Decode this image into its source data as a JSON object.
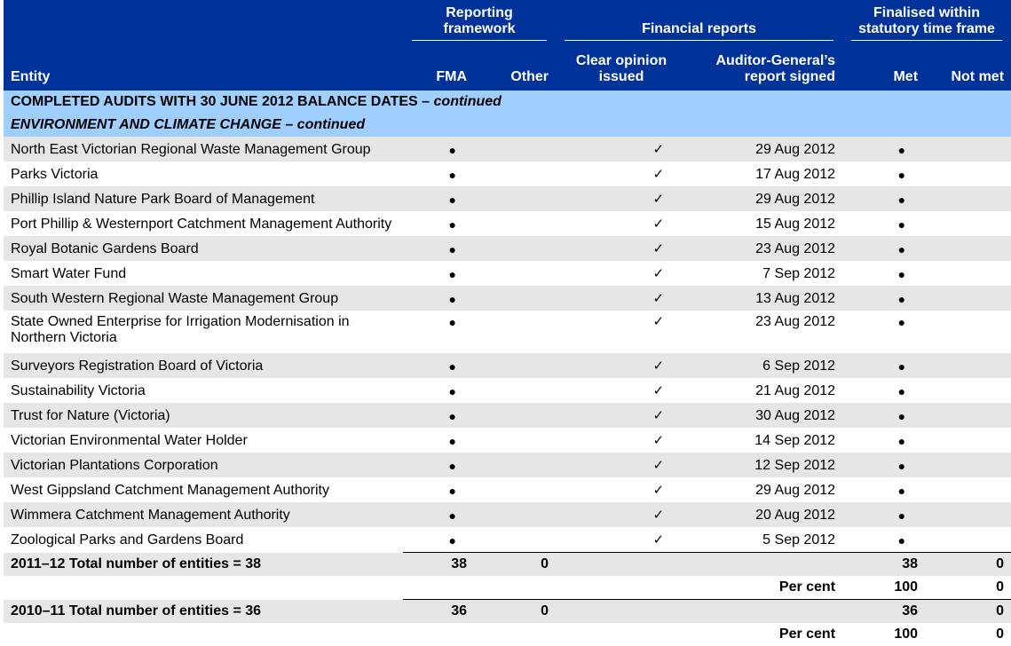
{
  "header": {
    "groups": {
      "reporting_framework": "Reporting framework",
      "financial_reports": "Financial reports",
      "finalised": "Finalised within statutory time frame"
    },
    "columns": {
      "entity": "Entity",
      "fma": "FMA",
      "other": "Other",
      "clear_opinion": "Clear opinion issued",
      "ag_signed": "Auditor-General’s report signed",
      "met": "Met",
      "not_met": "Not met"
    }
  },
  "sections": {
    "completed": "COMPLETED AUDITS WITH 30 JUNE 2012 BALANCE DATES – ",
    "completed_suffix": "continued",
    "portfolio": "ENVIRONMENT AND CLIMATE CHANGE – continued"
  },
  "symbols": {
    "bullet": "●",
    "tick": "✓"
  },
  "rows": [
    {
      "entity": "North East Victorian Regional Waste Management Group",
      "date": "29 Aug 2012"
    },
    {
      "entity": "Parks Victoria",
      "date": "17 Aug 2012"
    },
    {
      "entity": "Phillip Island Nature Park Board of Management",
      "date": "29 Aug 2012"
    },
    {
      "entity": "Port Phillip & Westernport Catchment Management Authority",
      "date": "15 Aug 2012"
    },
    {
      "entity": "Royal Botanic Gardens Board",
      "date": "23 Aug 2012"
    },
    {
      "entity": "Smart Water Fund",
      "date": "7 Sep 2012"
    },
    {
      "entity": "South Western Regional Waste Management Group",
      "date": "13 Aug 2012"
    },
    {
      "entity": "State Owned Enterprise for Irrigation Modernisation in Northern Victoria",
      "date": "23 Aug 2012"
    },
    {
      "entity": "Surveyors Registration Board of Victoria",
      "date": "6 Sep 2012"
    },
    {
      "entity": "Sustainability Victoria",
      "date": "21 Aug 2012"
    },
    {
      "entity": "Trust for Nature (Victoria)",
      "date": "30 Aug 2012"
    },
    {
      "entity": "Victorian Environmental Water Holder",
      "date": "14 Sep 2012"
    },
    {
      "entity": "Victorian Plantations Corporation",
      "date": "12 Sep 2012"
    },
    {
      "entity": "West Gippsland Catchment Management Authority",
      "date": "29 Aug 2012"
    },
    {
      "entity": "Wimmera Catchment Management Authority",
      "date": "20 Aug 2012"
    },
    {
      "entity": "Zoological Parks and Gardens Board",
      "date": "5 Sep 2012"
    }
  ],
  "totals": {
    "y2012": {
      "label": "2011–12 Total number of entities = 38",
      "fma": "38",
      "other": "0",
      "met": "38",
      "not_met": "0"
    },
    "y2012_pc": {
      "label": "Per cent",
      "met": "100",
      "not_met": "0"
    },
    "y2011": {
      "label": "2010–11 Total number of entities = 36",
      "fma": "36",
      "other": "0",
      "met": "36",
      "not_met": "0"
    },
    "y2011_pc": {
      "label": "Per cent",
      "met": "100",
      "not_met": "0"
    }
  }
}
